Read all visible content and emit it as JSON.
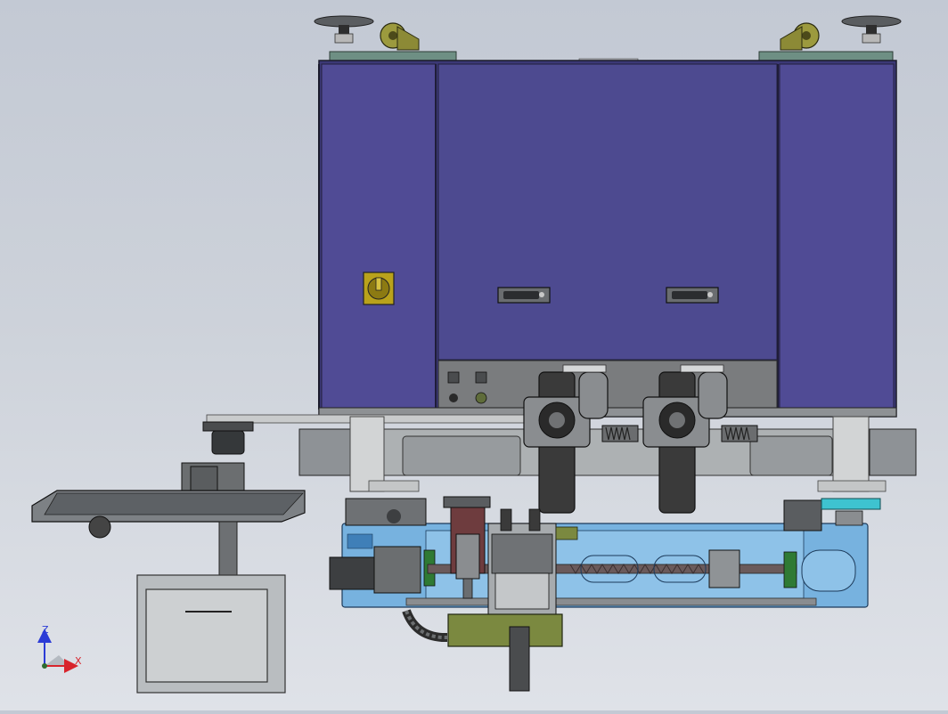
{
  "view": {
    "type": "CAD assembly model, front view",
    "background": [
      "#c3c9d4",
      "#dfe2e8"
    ]
  },
  "triad": {
    "z_label": "Z",
    "x_label": "X",
    "z_color": "#2b3bd6",
    "x_color": "#d8242c"
  },
  "colors": {
    "cabinet": "#4f4a92",
    "cabinet_center": "#4c4a8f",
    "frame": "#b4b8ba",
    "base_plate": "#77b2df",
    "base_plate_dark": "#3f7fb8",
    "olive_part": "#7b8940",
    "caster": "#9c9a3e",
    "dark_metal": "#3a3a3a",
    "mid_metal": "#8a8d90",
    "teal_block": "#3ec3d0",
    "maroon_bracket": "#6e3c3e",
    "yellow_switch": "#b9a21b",
    "leveling_foot": "#6e8f84"
  }
}
